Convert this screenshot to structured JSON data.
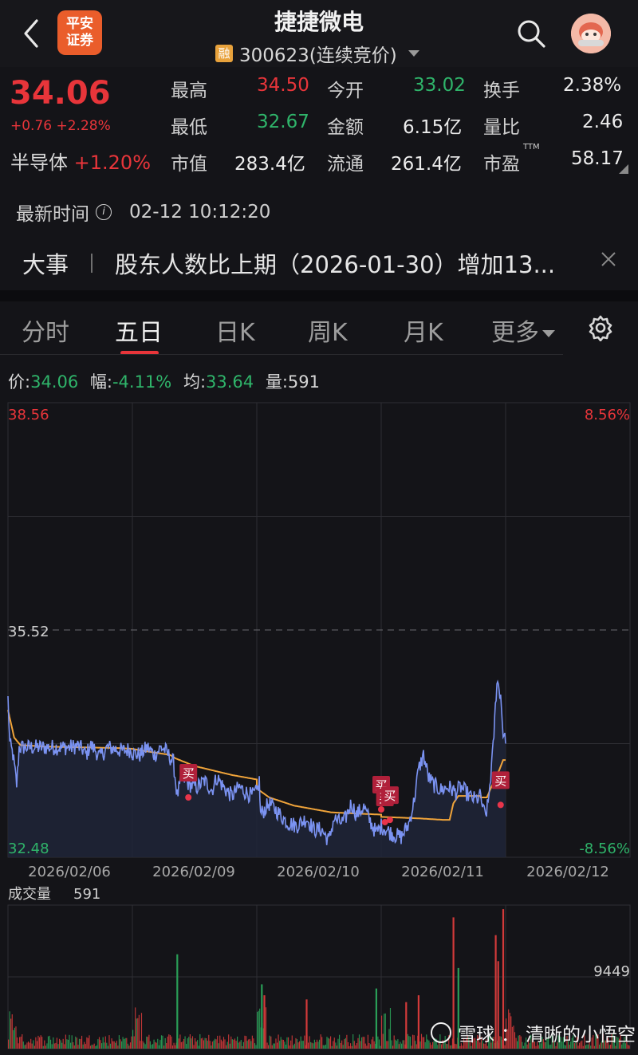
{
  "header": {
    "back_icon": "chevron-left-icon",
    "broker_logo_lines": [
      "平安",
      "证券"
    ],
    "stock_name": "捷捷微电",
    "margin_badge": "融",
    "stock_code": "300623(连续竞价)",
    "search_icon": "search-icon",
    "avatar_icon": "avatar-icon"
  },
  "quote": {
    "price": "34.06",
    "change": "+0.76 +2.28%",
    "sector_name": "半导体",
    "sector_change": "+1.20%",
    "stats": {
      "high_label": "最高",
      "high": "34.50",
      "low_label": "最低",
      "low": "32.67",
      "mktcap_label": "市值",
      "mktcap": "283.4亿",
      "open_label": "今开",
      "open": "33.02",
      "amount_label": "金额",
      "amount": "6.15亿",
      "float_label": "流通",
      "float": "261.4亿",
      "turnover_label": "换手",
      "turnover": "2.38%",
      "volratio_label": "量比",
      "volratio": "2.46",
      "pe_label": "市盈",
      "pe_suffix": "TTM",
      "pe": "58.17"
    },
    "update_label": "最新时间",
    "update_time": "02-12 10:12:20",
    "event_tag": "大事",
    "event_text": "股东人数比上期（2026-01-30）增加13..."
  },
  "tabs": [
    {
      "label": "分时",
      "active": false
    },
    {
      "label": "五日",
      "active": true
    },
    {
      "label": "日K",
      "active": false
    },
    {
      "label": "周K",
      "active": false
    },
    {
      "label": "月K",
      "active": false
    },
    {
      "label": "更多",
      "active": false
    }
  ],
  "chart_info": {
    "price_label": "价:",
    "price": "34.06",
    "range_label": "幅:",
    "range": "-4.11%",
    "avg_label": "均:",
    "avg": "33.64",
    "vol_label": "量:",
    "vol": "591"
  },
  "chart_data": {
    "type": "line",
    "title": "",
    "y_max_label": "38.56",
    "y_mid_label": "35.52",
    "y_min_label": "32.48",
    "pct_max_label": "8.56%",
    "pct_min_label": "-8.56%",
    "ylim": [
      32.48,
      38.56
    ],
    "prev_close": 35.52,
    "x_labels": [
      "2026/02/06",
      "2026/02/09",
      "2026/02/10",
      "2026/02/11",
      "2026/02/12"
    ],
    "series": [
      {
        "name": "price",
        "color": "#7b93f2",
        "anchors": [
          [
            0.0,
            34.6
          ],
          [
            0.015,
            34.0
          ],
          [
            0.04,
            33.85
          ],
          [
            0.07,
            33.45
          ],
          [
            0.09,
            33.95
          ],
          [
            0.15,
            33.95
          ],
          [
            0.2,
            33.95
          ],
          [
            0.3,
            33.95
          ],
          [
            0.4,
            33.95
          ],
          [
            0.5,
            33.95
          ],
          [
            0.56,
            33.97
          ],
          [
            0.6,
            33.92
          ],
          [
            0.63,
            33.85
          ],
          [
            0.66,
            33.98
          ],
          [
            0.7,
            33.92
          ],
          [
            0.74,
            33.82
          ],
          [
            0.8,
            33.95
          ],
          [
            0.86,
            33.93
          ],
          [
            0.92,
            33.9
          ],
          [
            0.97,
            33.92
          ],
          [
            1.0,
            33.9
          ],
          [
            1.0,
            33.87
          ],
          [
            1.06,
            33.85
          ],
          [
            1.12,
            33.95
          ],
          [
            1.18,
            33.85
          ],
          [
            1.23,
            33.95
          ],
          [
            1.26,
            33.92
          ],
          [
            1.33,
            33.75
          ],
          [
            1.36,
            33.3
          ],
          [
            1.4,
            33.55
          ],
          [
            1.46,
            33.45
          ],
          [
            1.52,
            33.42
          ],
          [
            1.58,
            33.5
          ],
          [
            1.64,
            33.38
          ],
          [
            1.68,
            33.55
          ],
          [
            1.74,
            33.4
          ],
          [
            1.8,
            33.3
          ],
          [
            1.86,
            33.42
          ],
          [
            1.91,
            33.35
          ],
          [
            1.96,
            33.3
          ],
          [
            2.0,
            33.35
          ],
          [
            2.02,
            33.5
          ],
          [
            2.03,
            33.05
          ],
          [
            2.1,
            33.2
          ],
          [
            2.16,
            33.1
          ],
          [
            2.24,
            32.95
          ],
          [
            2.32,
            32.9
          ],
          [
            2.4,
            33.0
          ],
          [
            2.46,
            32.85
          ],
          [
            2.52,
            32.85
          ],
          [
            2.58,
            32.7
          ],
          [
            2.62,
            33.0
          ],
          [
            2.66,
            32.95
          ],
          [
            2.7,
            32.95
          ],
          [
            2.76,
            33.2
          ],
          [
            2.8,
            33.05
          ],
          [
            2.86,
            33.15
          ],
          [
            2.9,
            33.0
          ],
          [
            2.96,
            32.8
          ],
          [
            3.0,
            32.9
          ],
          [
            3.04,
            32.85
          ],
          [
            3.1,
            32.78
          ],
          [
            3.16,
            32.75
          ],
          [
            3.22,
            32.92
          ],
          [
            3.26,
            33.2
          ],
          [
            3.3,
            33.65
          ],
          [
            3.34,
            33.85
          ],
          [
            3.38,
            33.55
          ],
          [
            3.42,
            33.45
          ],
          [
            3.48,
            33.38
          ],
          [
            3.54,
            33.42
          ],
          [
            3.6,
            33.35
          ],
          [
            3.64,
            33.42
          ],
          [
            3.68,
            33.35
          ],
          [
            3.72,
            33.28
          ],
          [
            3.76,
            33.25
          ],
          [
            3.8,
            33.3
          ],
          [
            3.82,
            33.1
          ],
          [
            3.84,
            33.05
          ],
          [
            3.86,
            33.2
          ],
          [
            3.9,
            33.95
          ],
          [
            3.93,
            34.85
          ],
          [
            3.96,
            34.65
          ],
          [
            3.98,
            34.15
          ],
          [
            4.0,
            34.0
          ]
        ]
      },
      {
        "name": "average",
        "color": "#f0a43a",
        "anchors": [
          [
            0.0,
            34.45
          ],
          [
            0.05,
            34.08
          ],
          [
            0.1,
            33.98
          ],
          [
            0.3,
            33.96
          ],
          [
            0.6,
            33.95
          ],
          [
            0.9,
            33.94
          ],
          [
            1.0,
            33.93
          ],
          [
            1.0,
            33.93
          ],
          [
            1.1,
            33.9
          ],
          [
            1.3,
            33.85
          ],
          [
            1.35,
            33.8
          ],
          [
            1.5,
            33.7
          ],
          [
            1.8,
            33.58
          ],
          [
            2.0,
            33.52
          ],
          [
            2.0,
            33.4
          ],
          [
            2.1,
            33.28
          ],
          [
            2.3,
            33.17
          ],
          [
            2.6,
            33.08
          ],
          [
            3.0,
            33.05
          ],
          [
            3.0,
            33.02
          ],
          [
            3.3,
            33.0
          ],
          [
            3.5,
            32.98
          ],
          [
            3.55,
            32.98
          ],
          [
            3.58,
            33.2
          ],
          [
            3.62,
            33.3
          ],
          [
            3.8,
            33.3
          ],
          [
            3.8,
            33.28
          ],
          [
            3.85,
            33.28
          ],
          [
            3.88,
            33.4
          ],
          [
            3.95,
            33.65
          ],
          [
            3.98,
            33.78
          ],
          [
            4.0,
            33.78
          ]
        ]
      }
    ],
    "buy_markers": [
      {
        "label": "买",
        "x": 1.45,
        "y": 33.28
      },
      {
        "label": "买",
        "x": 3.0,
        "y": 33.12
      },
      {
        "label": "买",
        "x": 3.03,
        "y": 32.95
      },
      {
        "label": "买",
        "x": 3.07,
        "y": 32.98
      },
      {
        "label": "买",
        "x": 3.96,
        "y": 33.18
      }
    ],
    "volume": {
      "label": "成交量",
      "value": "591",
      "scale_label": "9449",
      "bars_per_day": 100,
      "up_color": "#d23a3a",
      "down_color": "#2a9e57",
      "spikes": [
        {
          "x": 3.58,
          "value": 9600,
          "color": "#d23a3a"
        },
        {
          "x": 3.98,
          "value": 10200,
          "color": "#d23a3a"
        },
        {
          "x": 3.92,
          "value": 8300,
          "color": "#d23a3a"
        },
        {
          "x": 3.94,
          "value": 6400,
          "color": "#d23a3a"
        },
        {
          "x": 1.36,
          "value": 6900,
          "color": "#2a9e57"
        },
        {
          "x": 2.04,
          "value": 4700,
          "color": "#2a9e57"
        },
        {
          "x": 2.96,
          "value": 4400,
          "color": "#2a9e57"
        },
        {
          "x": 3.62,
          "value": 5900,
          "color": "#2a9e57"
        },
        {
          "x": 3.3,
          "value": 3900,
          "color": "#d23a3a"
        },
        {
          "x": 2.4,
          "value": 3600,
          "color": "#d23a3a"
        },
        {
          "x": 3.2,
          "value": 3400,
          "color": "#d23a3a"
        },
        {
          "x": 2.06,
          "value": 3900,
          "color": "#d23a3a"
        }
      ]
    }
  },
  "watermark": {
    "brand": "雪球",
    "separator": "：",
    "author": "清晰的小悟空"
  }
}
